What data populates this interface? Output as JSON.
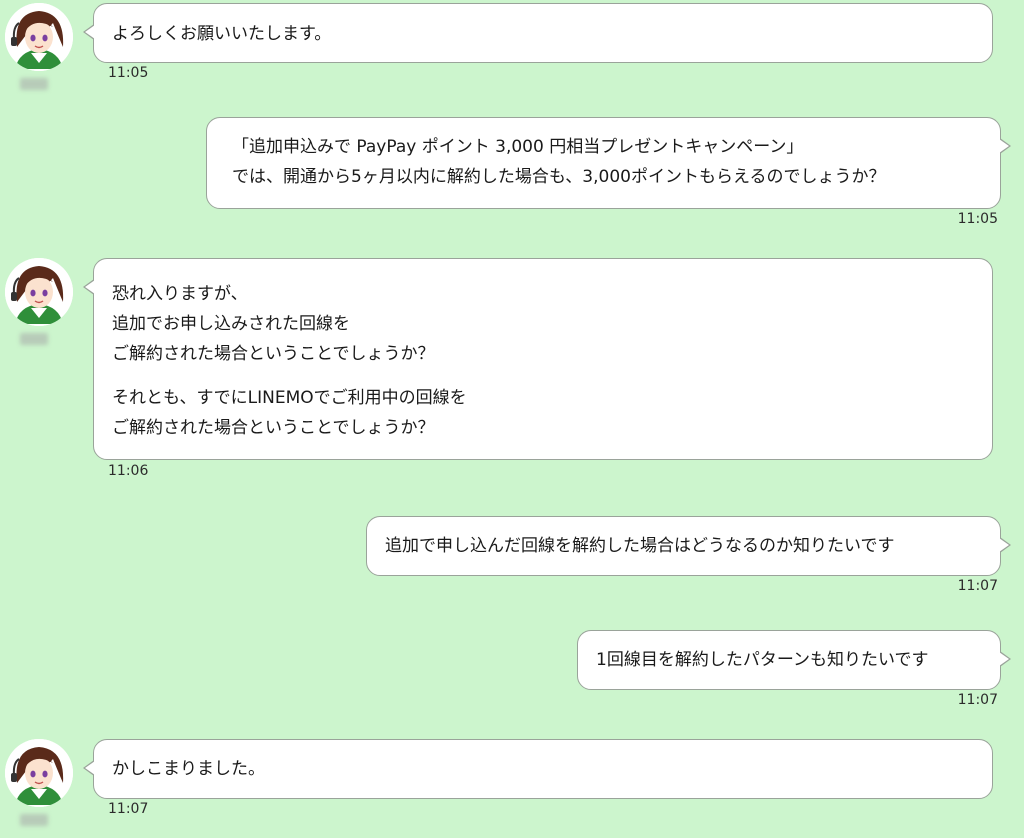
{
  "messages": [
    {
      "side": "agent",
      "lines": [
        "よろしくお願いいたします。"
      ],
      "time": "11:05"
    },
    {
      "side": "user",
      "lines": [
        "「追加申込みで PayPay ポイント 3,000 円相当プレゼントキャンペーン」",
        "では、開通から5ヶ月以内に解約した場合も、3,000ポイントもらえるのでしょうか？"
      ],
      "time": "11:05"
    },
    {
      "side": "agent",
      "lines": [
        "恐れ入りますが、",
        "追加でお申し込みされた回線を",
        "ご解約された場合ということでしょうか？",
        "それとも、すでにLINEMOでご利用中の回線を",
        "ご解約された場合ということでしょうか？"
      ],
      "time": "11:06"
    },
    {
      "side": "user",
      "lines": [
        "追加で申し込んだ回線を解約した場合はどうなるのか知りたいです"
      ],
      "time": "11:07"
    },
    {
      "side": "user",
      "lines": [
        "1回線目を解約したパターンも知りたいです"
      ],
      "time": "11:07"
    },
    {
      "side": "agent",
      "lines": [
        "かしこまりました。"
      ],
      "time": "11:07"
    }
  ],
  "theme": {
    "background": "#ccf5cd",
    "bubble": "#ffffff",
    "bubble_border": "#9aa39a"
  }
}
